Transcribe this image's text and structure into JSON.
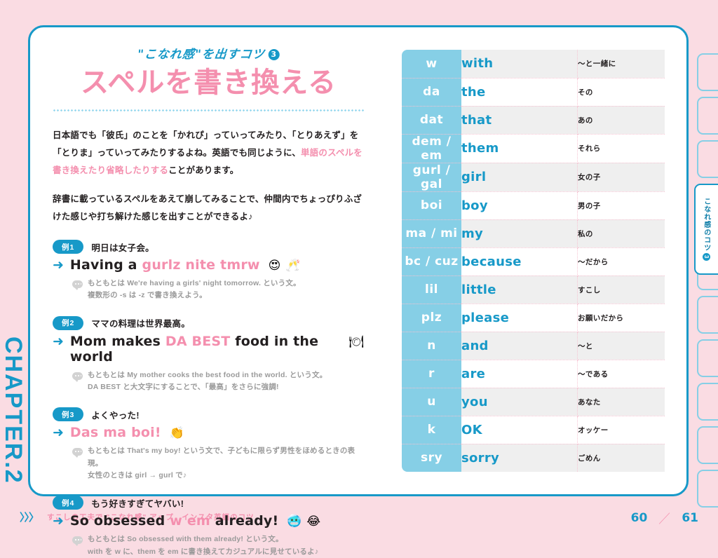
{
  "chapter_rail": {
    "label": "CHAPTER.2"
  },
  "side_tabs": {
    "active_label": "こなれ感のコツ",
    "active_number": "3",
    "inactive_count": 9
  },
  "heading": {
    "eyebrow": "\"こなれ感\"を出すコツ",
    "eyebrow_number": "3",
    "title": "スペルを書き換える"
  },
  "intro": {
    "p1_a": "日本語でも「彼氏」のことを「かれぴ」っていってみたり、「とりあえず」を「とりま」っていってみたりするよね。英語でも同じように、",
    "p1_hl": "単語のスペルを書き換えたり省略したりする",
    "p1_b": "ことがあります。",
    "p2": "辞書に載っているスペルをあえて崩してみることで、仲間内でちょっぴりふざけた感じや打ち解けた感じを出すことができるよ♪"
  },
  "examples": [
    {
      "badge": "例1",
      "jp": "明日は女子会。",
      "en_pre": "Having a ",
      "en_pink": "gurlz nite tmrw",
      "en_post": "",
      "emoji": "😍 🥂",
      "note_line1": "もともとは We're having a girls' night tomorrow. という文。",
      "note_line2": "複数形の -s は -z で書き換えよう。"
    },
    {
      "badge": "例2",
      "jp": "ママの料理は世界最高。",
      "en_pre": "Mom makes ",
      "en_pink": "DA BEST",
      "en_post": " food in the world",
      "emoji": "🍽",
      "note_line1": "もともとは My mother cooks the best food in the world. という文。",
      "note_line2": "DA BEST と大文字にすることで、「最高」をさらに強調!"
    },
    {
      "badge": "例3",
      "jp": "よくやった!",
      "en_pre": "",
      "en_pink": "Das ma boi!",
      "en_post": "",
      "all_pink": true,
      "emoji": "👏",
      "note_line1": "もともとは That's my boy! という文で、子どもに限らず男性をほめるときの表現。",
      "note_line2": "女性のときは girl → gurl で♪"
    },
    {
      "badge": "例4",
      "jp": "もう好きすぎてヤバい!",
      "en_pre": "So obsessed ",
      "en_pink": "w em",
      "en_post": " already!",
      "emoji": "🥶 😂",
      "note_line1": "もともとは So obsessed with them already! という文。",
      "note_line2": "with を w に、them を em に書き換えてカジュアルに見せているよ♪"
    }
  ],
  "table": {
    "rows": [
      {
        "abbr": "w",
        "full": "with",
        "jp": "〜と一緒に"
      },
      {
        "abbr": "da",
        "full": "the",
        "jp": "その"
      },
      {
        "abbr": "dat",
        "full": "that",
        "jp": "あの"
      },
      {
        "abbr": "dem / em",
        "full": "them",
        "jp": "それら"
      },
      {
        "abbr": "gurl / gal",
        "full": "girl",
        "jp": "女の子"
      },
      {
        "abbr": "boi",
        "full": "boy",
        "jp": "男の子"
      },
      {
        "abbr": "ma / mi",
        "full": "my",
        "jp": "私の"
      },
      {
        "abbr": "bc / cuz",
        "full": "because",
        "jp": "〜だから"
      },
      {
        "abbr": "lil",
        "full": "little",
        "jp": "すこし"
      },
      {
        "abbr": "plz",
        "full": "please",
        "jp": "お願いだから"
      },
      {
        "abbr": "n",
        "full": "and",
        "jp": "〜と"
      },
      {
        "abbr": "r",
        "full": "are",
        "jp": "〜である"
      },
      {
        "abbr": "u",
        "full": "you",
        "jp": "あなた"
      },
      {
        "abbr": "k",
        "full": "OK",
        "jp": "オッケー"
      },
      {
        "abbr": "sry",
        "full": "sorry",
        "jp": "ごめん"
      }
    ]
  },
  "footer": {
    "chevrons": "〉〉〉",
    "text": "すこしの工夫で \"こなれ感\" アップ　インスタ英語のコツ",
    "page_left": "60",
    "slash": "／",
    "page_right": "61"
  },
  "colors": {
    "page_bg": "#fadce3",
    "cyan": "#1799c8",
    "light_cyan": "#86cfe6",
    "pink": "#f48fae",
    "dotted_pink": "#f6c3d2",
    "row_gray": "#efefef"
  }
}
